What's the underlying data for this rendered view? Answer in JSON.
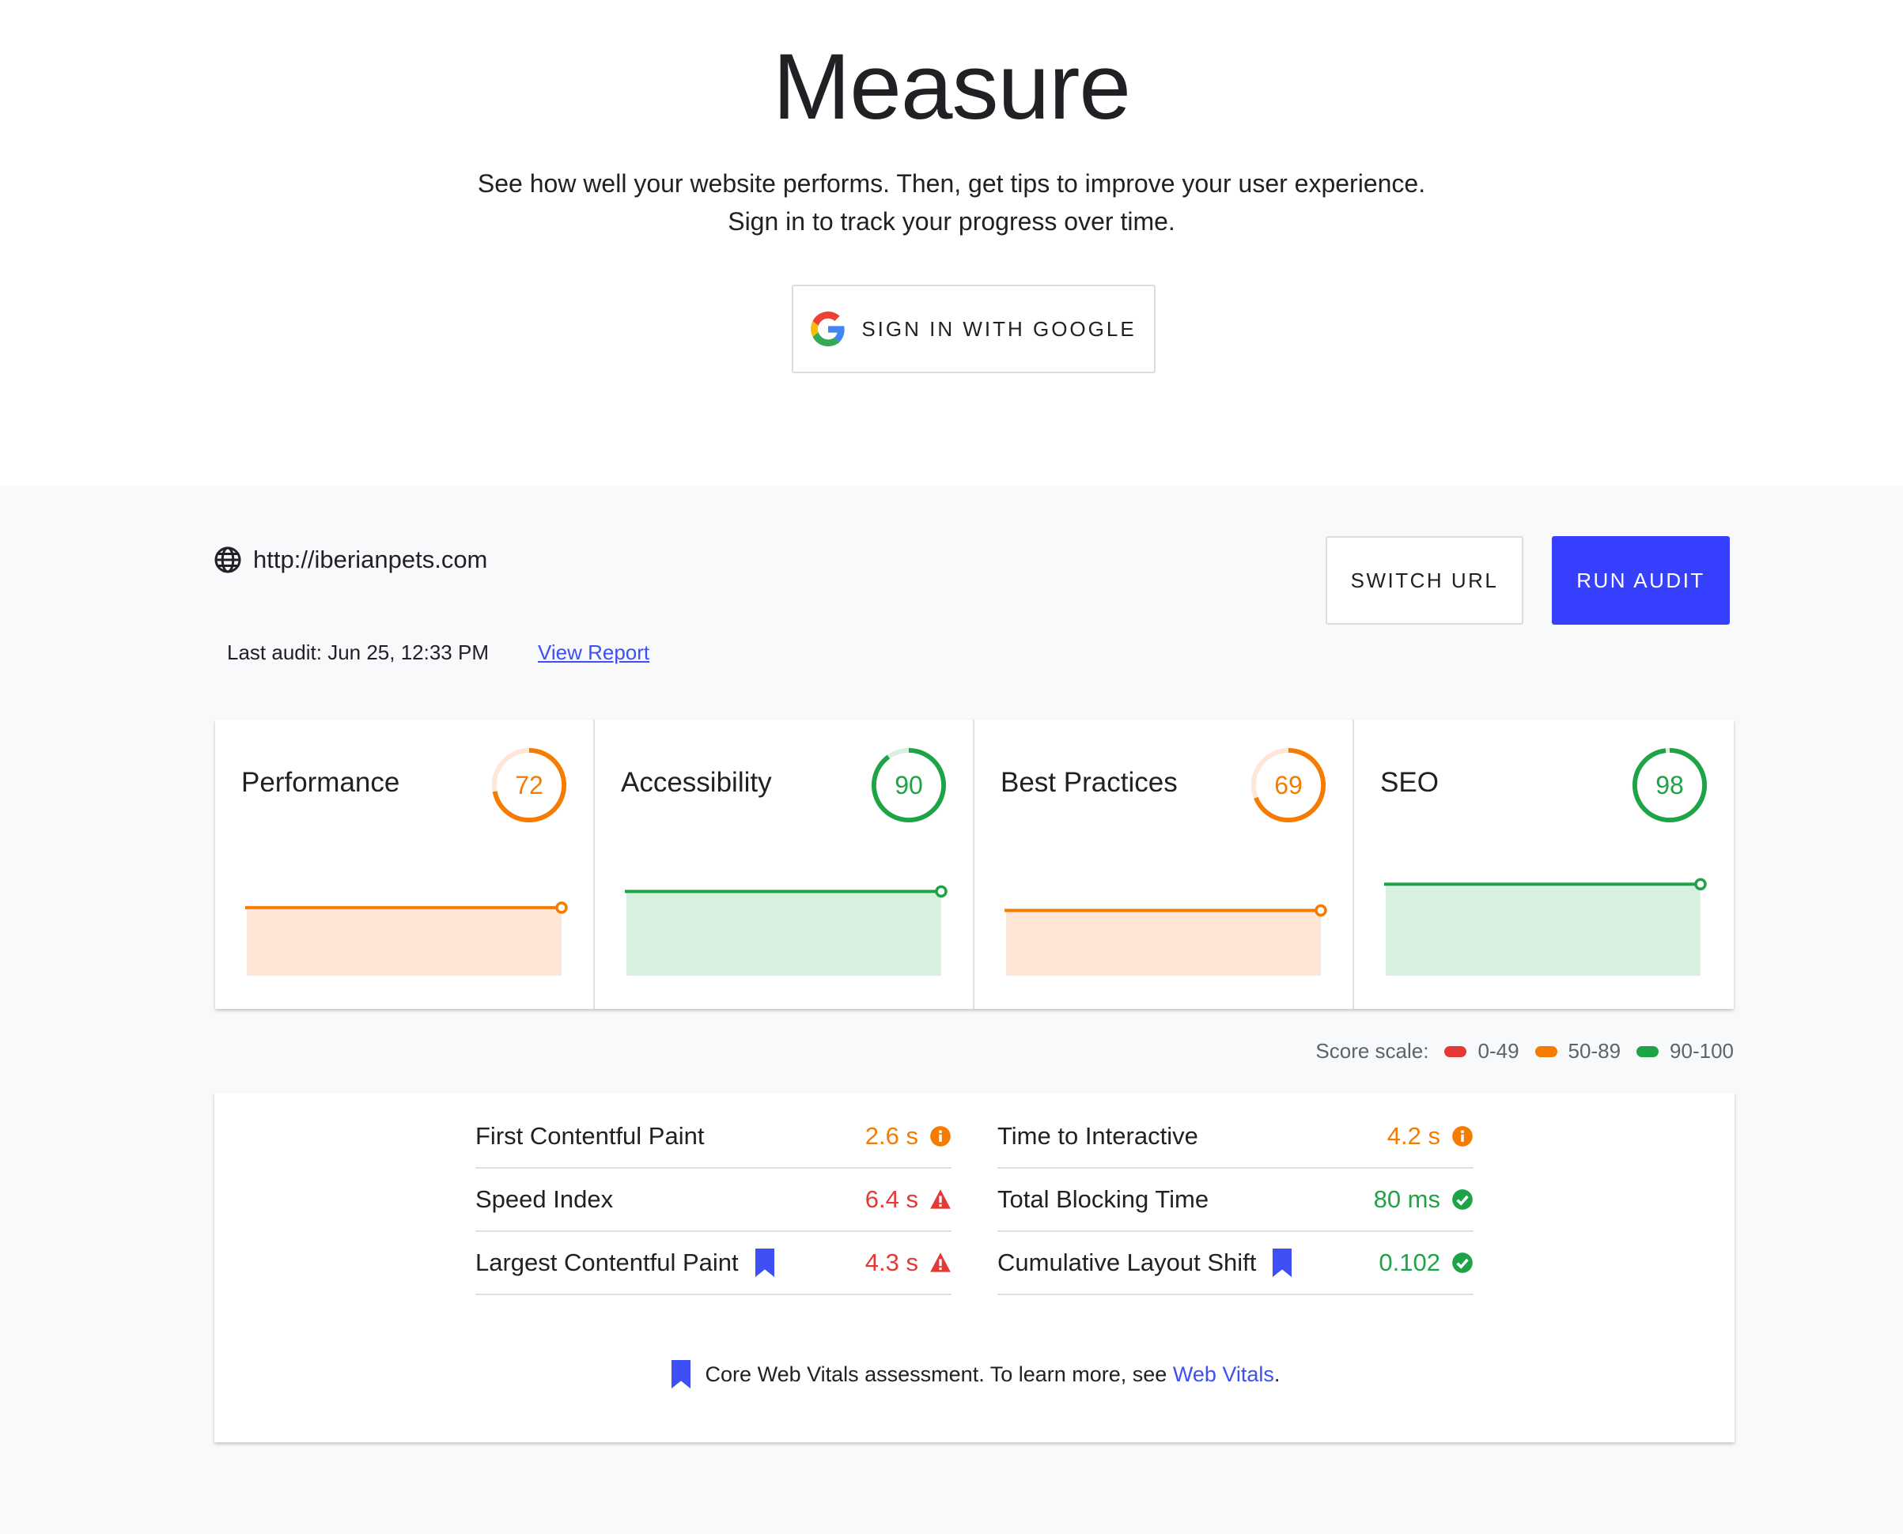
{
  "hero": {
    "title": "Measure",
    "subtitle_line1": "See how well your website performs. Then, get tips to improve your user experience.",
    "subtitle_line2": "Sign in to track your progress over time.",
    "signin_label": "SIGN IN WITH GOOGLE"
  },
  "site": {
    "url": "http://iberianpets.com",
    "last_audit": "Last audit: Jun 25, 12:33 PM",
    "view_report": "View Report",
    "switch_url": "SWITCH URL",
    "run_audit": "RUN AUDIT"
  },
  "scores": [
    {
      "title": "Performance",
      "score": "72",
      "color": "#f57c00",
      "fill": "#ffe6d6",
      "track": "#ffe6d6"
    },
    {
      "title": "Accessibility",
      "score": "90",
      "color": "#1ea446",
      "fill": "#d8f0e0",
      "track": "#d8f0e0"
    },
    {
      "title": "Best Practices",
      "score": "69",
      "color": "#f57c00",
      "fill": "#ffe6d6",
      "track": "#ffe6d6"
    },
    {
      "title": "SEO",
      "score": "98",
      "color": "#1ea446",
      "fill": "#d8f0e0",
      "track": "#d8f0e0"
    }
  ],
  "score_scale": {
    "label": "Score scale:",
    "ranges": [
      {
        "label": "0-49",
        "color": "#e53935"
      },
      {
        "label": "50-89",
        "color": "#f57c00"
      },
      {
        "label": "90-100",
        "color": "#1ea446"
      }
    ]
  },
  "metrics": {
    "left": [
      {
        "label": "First Contentful Paint",
        "value": "2.6 s",
        "status": "info",
        "color": "#f57c00",
        "bookmark": false
      },
      {
        "label": "Speed Index",
        "value": "6.4 s",
        "status": "warn",
        "color": "#e53935",
        "bookmark": false
      },
      {
        "label": "Largest Contentful Paint",
        "value": "4.3 s",
        "status": "warn",
        "color": "#e53935",
        "bookmark": true
      }
    ],
    "right": [
      {
        "label": "Time to Interactive",
        "value": "4.2 s",
        "status": "info",
        "color": "#f57c00",
        "bookmark": false
      },
      {
        "label": "Total Blocking Time",
        "value": "80 ms",
        "status": "pass",
        "color": "#1ea446",
        "bookmark": false
      },
      {
        "label": "Cumulative Layout Shift",
        "value": "0.102",
        "status": "pass",
        "color": "#1ea446",
        "bookmark": true
      }
    ],
    "cwv_text": "Core Web Vitals assessment. To learn more, see",
    "cwv_link": "Web Vitals",
    "cwv_end": "."
  },
  "colors": {
    "accent": "#3740ff",
    "link": "#3d4ff5",
    "bookmark": "#3d4ff5"
  }
}
